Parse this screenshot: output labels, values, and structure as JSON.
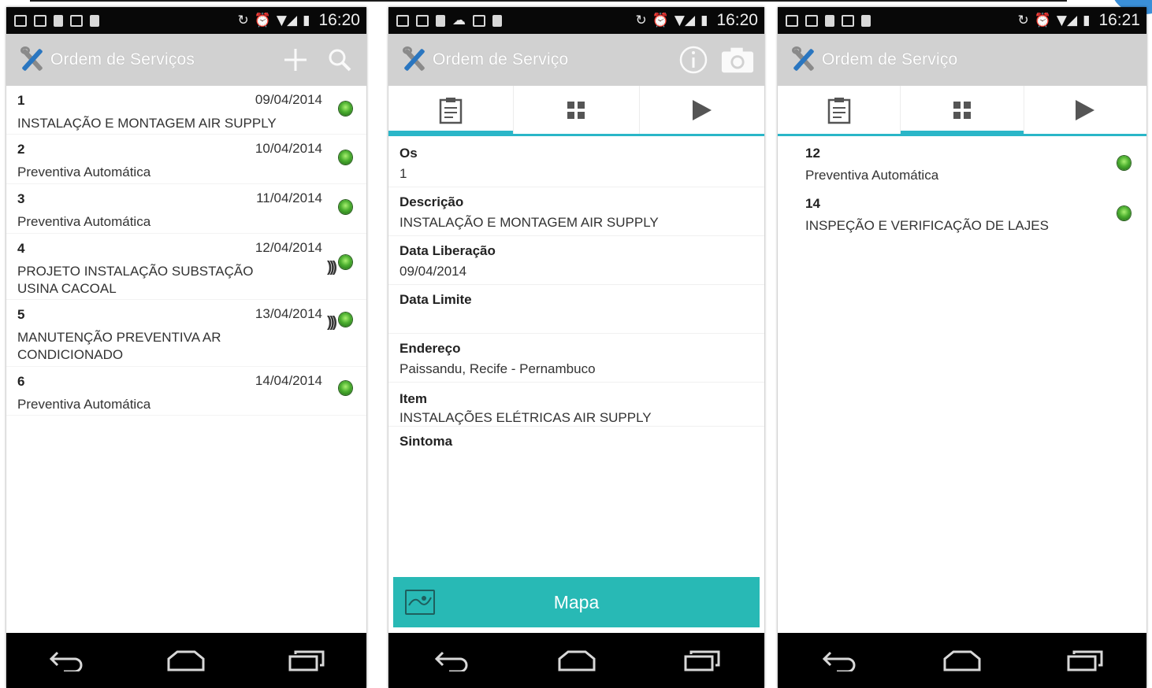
{
  "status_time": {
    "phone1": "16:20",
    "phone2": "16:20",
    "phone3": "16:21"
  },
  "phone1": {
    "title": "Ordem de Serviços",
    "orders": [
      {
        "num": "1",
        "date": "09/04/2014",
        "desc": "INSTALAÇÃO E MONTAGEM AIR SUPPLY"
      },
      {
        "num": "2",
        "date": "10/04/2014",
        "desc": "Preventiva Automática"
      },
      {
        "num": "3",
        "date": "11/04/2014",
        "desc": "Preventiva Automática"
      },
      {
        "num": "4",
        "date": "12/04/2014",
        "desc": "PROJETO INSTALAÇÃO SUBSTAÇÃO USINA CACOAL"
      },
      {
        "num": "5",
        "date": "13/04/2014",
        "desc": "MANUTENÇÃO PREVENTIVA AR CONDICIONADO"
      },
      {
        "num": "6",
        "date": "14/04/2014",
        "desc": "Preventiva Automática"
      }
    ]
  },
  "phone2": {
    "title": "Ordem de Serviço",
    "fields": [
      {
        "label": "Os",
        "value": "1"
      },
      {
        "label": "Descrição",
        "value": "INSTALAÇÃO E MONTAGEM AIR SUPPLY"
      },
      {
        "label": "Data Liberação",
        "value": "09/04/2014"
      },
      {
        "label": "Data Limite",
        "value": ""
      },
      {
        "label": "Endereço",
        "value": "Paissandu, Recife - Pernambuco"
      },
      {
        "label": "Item",
        "value": "INSTALAÇÕES ELÉTRICAS AIR SUPPLY"
      },
      {
        "label": "Sintoma",
        "value": ""
      }
    ],
    "map_button": "Mapa"
  },
  "phone3": {
    "title": "Ordem de Serviço",
    "orders": [
      {
        "num": "12",
        "desc": "Preventiva Automática"
      },
      {
        "num": "14",
        "desc": "INSPEÇÃO E VERIFICAÇÃO DE LAJES"
      }
    ]
  },
  "icons": {
    "status_led": "green-led-icon",
    "nfc": "nfc-signal-icon",
    "tabs": [
      "clipboard-icon",
      "grid-icon",
      "play-icon"
    ],
    "action_bar_list": [
      "add-icon",
      "search-icon"
    ],
    "action_bar_detail": [
      "info-icon",
      "camera-icon"
    ],
    "nav": [
      "back-icon",
      "home-icon",
      "recent-apps-icon"
    ]
  },
  "colors": {
    "accent": "#2ab6c8",
    "map_button": "#28b9b5",
    "status_led": "#4caf30",
    "action_bar": "#d1d1d1"
  }
}
